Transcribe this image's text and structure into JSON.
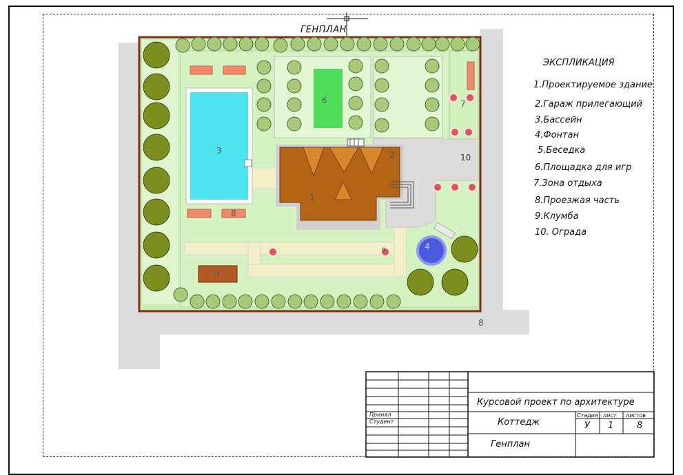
{
  "plan_title": "ГЕНПЛАН",
  "legend": {
    "title": "ЭКСПЛИКАЦИЯ",
    "items": [
      "1.Проектируемое здание",
      "2.Гараж прилегающий",
      "3.Бассейн",
      "4.Фонтан",
      "5.Беседка",
      "6.Площадка для игр",
      "7.Зона отдыха",
      "8.Проезжая часть",
      "9.Клумба",
      "10.  Ограда"
    ]
  },
  "plan_labels": {
    "building": "1",
    "garage": "2",
    "pool": "3",
    "fountain": "4",
    "gazebo": "5",
    "playground": "6",
    "rest_zone": "7",
    "road_a": "8",
    "road_b": "8",
    "flowerbed": "9",
    "fence": "10"
  },
  "stamp": {
    "course": "Курсовой проект по архитектуре",
    "object": "Коттедж",
    "sheet_name": "Генплан",
    "checked_label": "Принял",
    "student_label": "Студент",
    "stage_header": "Стадия",
    "sheet_header": "лист",
    "sheets_header": "листов",
    "stage_value": "У",
    "sheet_value": "1",
    "sheets_value": "8"
  },
  "colors": {
    "lawn": "#c9efb4",
    "lawn_light": "#e2f7d3",
    "path": "#f3f0c8",
    "road": "#dcdcdc",
    "pool": "#4fe3ef",
    "roof": "#b36414",
    "fence": "#7a2f10",
    "tree": "#7c8f1e",
    "shrub": "#a8c87a",
    "flower": "#d8585c",
    "bench": "#ee8a6a",
    "playground": "#4fdc5a"
  }
}
